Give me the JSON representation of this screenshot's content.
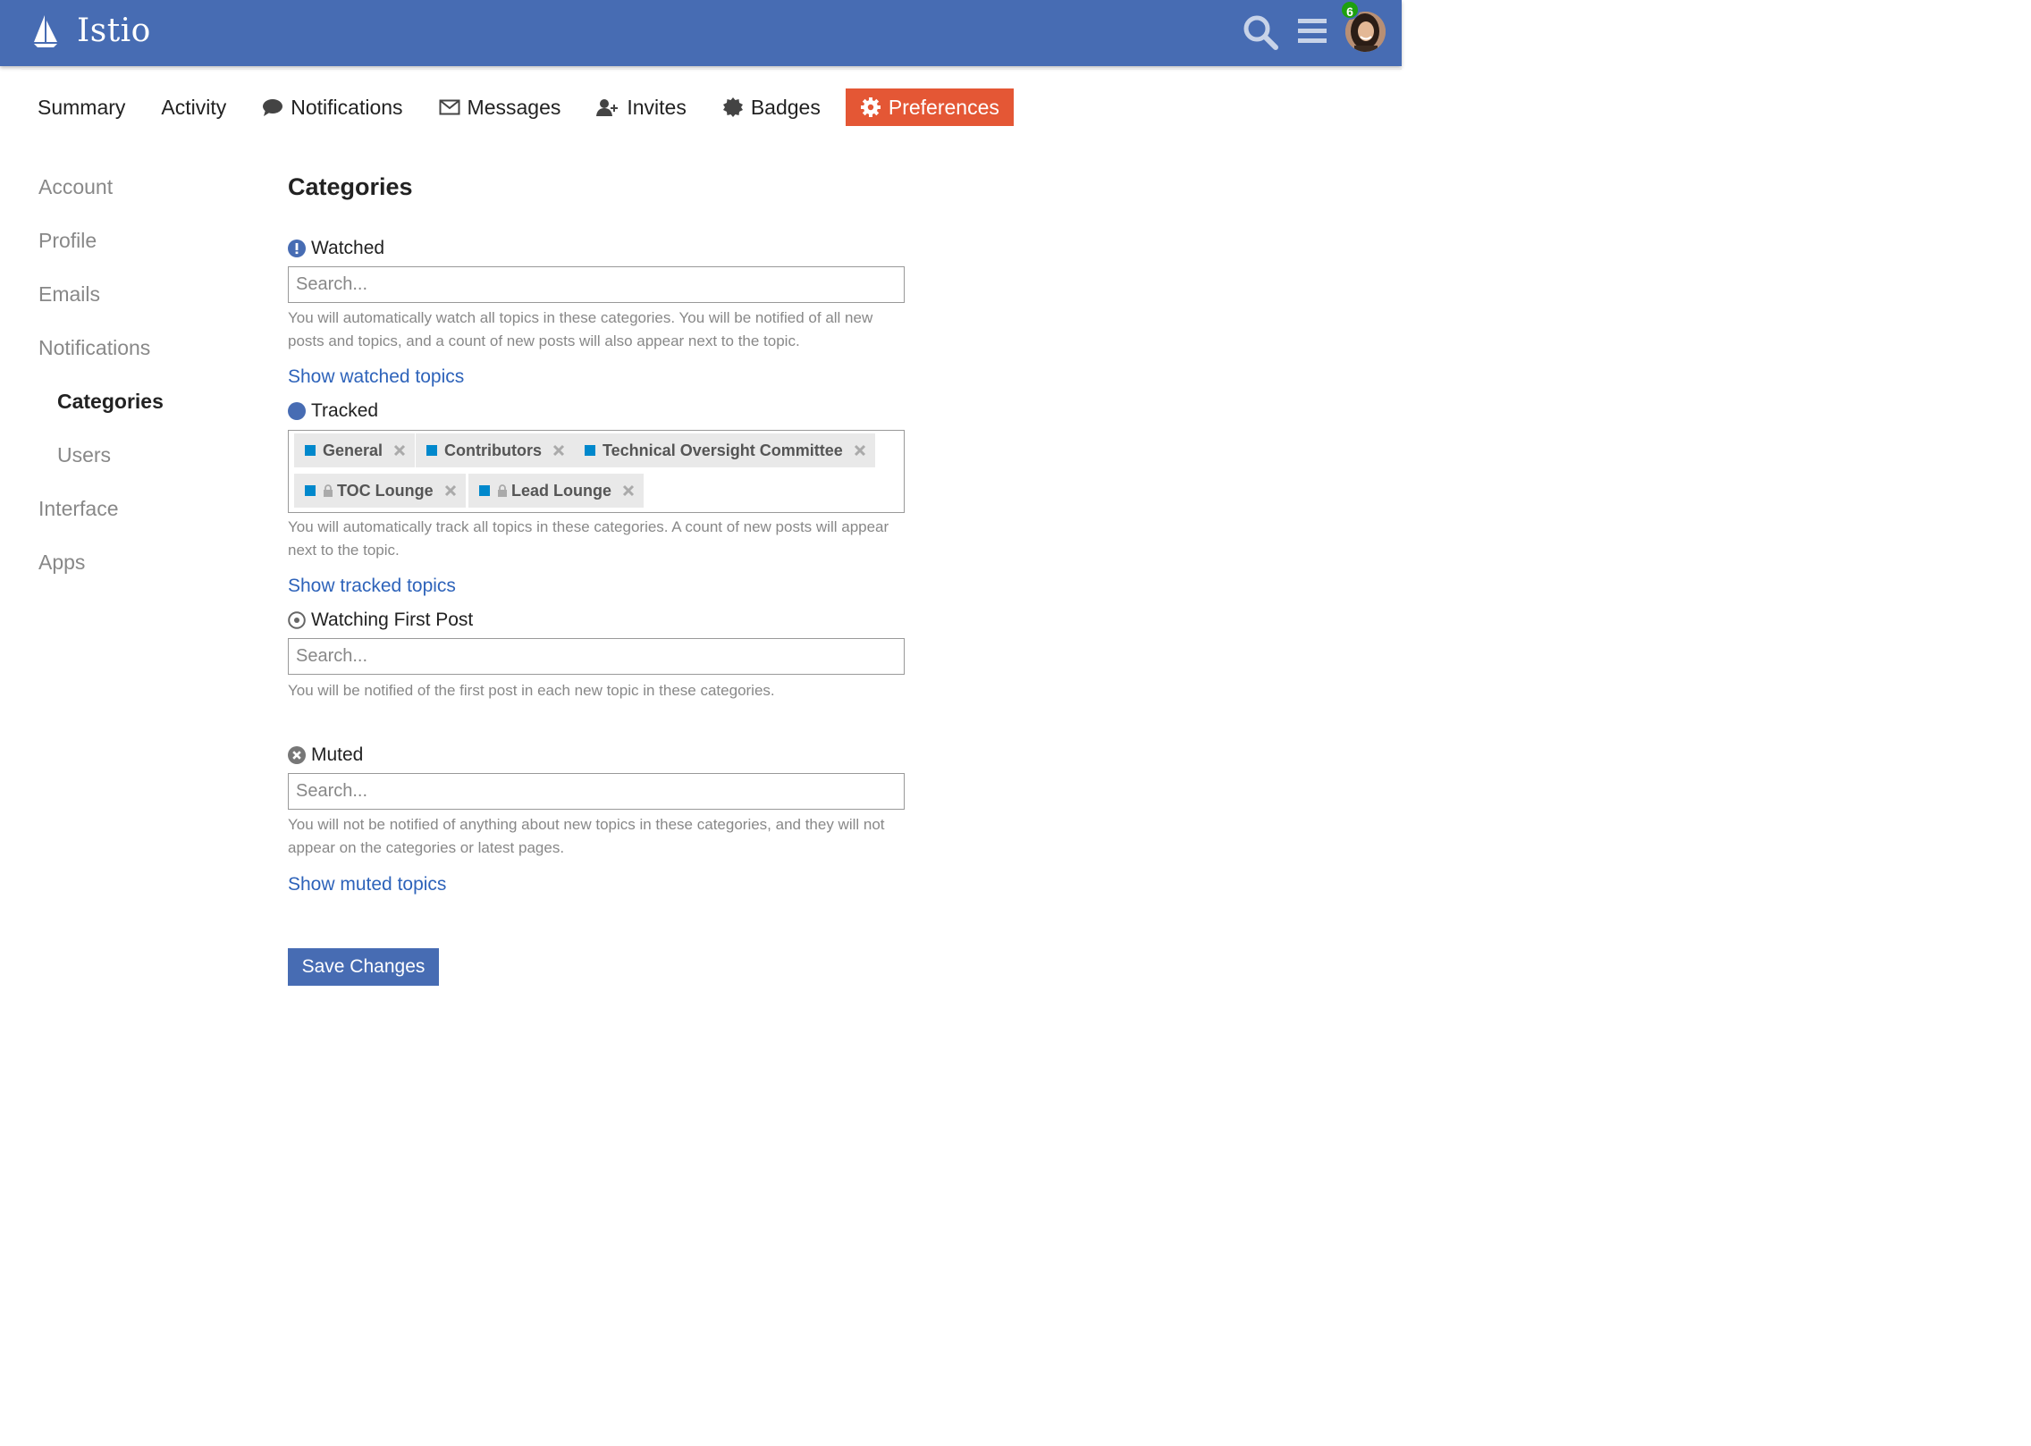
{
  "header": {
    "site_name": "Istio",
    "notification_count": "6",
    "accent": "#476cb3"
  },
  "nav": {
    "tabs": [
      {
        "label": "Summary",
        "icon": ""
      },
      {
        "label": "Activity",
        "icon": ""
      },
      {
        "label": "Notifications",
        "icon": "comment-icon"
      },
      {
        "label": "Messages",
        "icon": "envelope-icon"
      },
      {
        "label": "Invites",
        "icon": "user-plus-icon"
      },
      {
        "label": "Badges",
        "icon": "badge-icon"
      },
      {
        "label": "Preferences",
        "icon": "gear-icon",
        "active": true
      }
    ],
    "active_color": "#e45735"
  },
  "sidebar": {
    "items": [
      {
        "label": "Account"
      },
      {
        "label": "Profile"
      },
      {
        "label": "Emails"
      },
      {
        "label": "Notifications"
      },
      {
        "label": "Categories",
        "current": true
      },
      {
        "label": "Users"
      },
      {
        "label": "Interface"
      },
      {
        "label": "Apps"
      }
    ]
  },
  "main": {
    "title": "Categories",
    "watched": {
      "label": "Watched",
      "placeholder": "Search...",
      "help": "You will automatically watch all topics in these categories. You will be notified of all new posts and topics, and a count of new posts will also appear next to the topic.",
      "link": "Show watched topics"
    },
    "tracked": {
      "label": "Tracked",
      "tags": [
        {
          "label": "General",
          "locked": false
        },
        {
          "label": "Contributors",
          "locked": false
        },
        {
          "label": "Technical Oversight Committee",
          "locked": false
        },
        {
          "label": "TOC Lounge",
          "locked": true
        },
        {
          "label": "Lead Lounge",
          "locked": true
        }
      ],
      "tag_color": "#0088cc",
      "help": "You will automatically track all topics in these categories. A count of new posts will appear next to the topic.",
      "link": "Show tracked topics"
    },
    "watching_first_post": {
      "label": "Watching First Post",
      "placeholder": "Search...",
      "help": "You will be notified of the first post in each new topic in these categories."
    },
    "muted": {
      "label": "Muted",
      "placeholder": "Search...",
      "help": "You will not be notified of anything about new topics in these categories, and they will not appear on the categories or latest pages.",
      "link": "Show muted topics"
    },
    "save_label": "Save Changes"
  }
}
